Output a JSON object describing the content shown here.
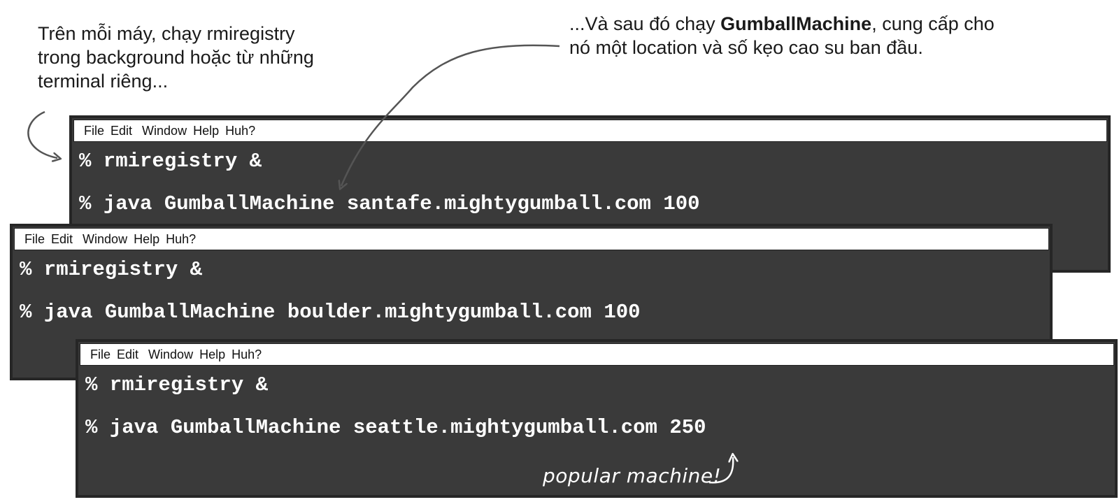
{
  "notes": {
    "left": [
      "Trên mỗi máy, chạy rmiregistry",
      "trong background hoặc từ những",
      "terminal riêng..."
    ],
    "right": {
      "line1_before": "...Và sau đó chạy ",
      "line1_bold": "GumballMachine",
      "line1_after": ", cung cấp cho",
      "line2": "nó một location và số kẹo cao su ban đầu."
    }
  },
  "terminals": [
    {
      "menu": [
        "File",
        "Edit",
        "Window",
        "Help",
        "Huh?"
      ],
      "lines": [
        "% rmiregistry &",
        "% java GumballMachine santafe.mightygumball.com 100"
      ]
    },
    {
      "menu": [
        "File",
        "Edit",
        "Window",
        "Help",
        "Huh?"
      ],
      "lines": [
        "% rmiregistry &",
        "% java GumballMachine boulder.mightygumball.com 100"
      ]
    },
    {
      "menu": [
        "File",
        "Edit",
        "Window",
        "Help",
        "Huh?"
      ],
      "lines": [
        "% rmiregistry &",
        "% java GumballMachine seattle.mightygumball.com 250"
      ]
    }
  ],
  "handwritten_note": "popular machine!",
  "colors": {
    "terminal_bg": "#3a3a3a",
    "terminal_text": "#ffffff",
    "arrow": "#555555"
  },
  "icons": [
    "curved-arrow-icon",
    "curved-arrow-icon",
    "curved-arrow-icon"
  ]
}
